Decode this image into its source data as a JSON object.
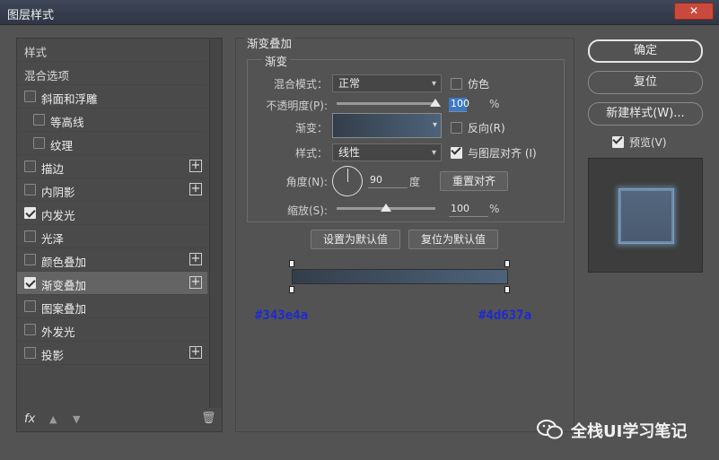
{
  "window": {
    "title": "图层样式",
    "close_label": "✕"
  },
  "sidebar": {
    "items": [
      {
        "label": "样式",
        "type": "header"
      },
      {
        "label": "混合选项",
        "type": "header"
      },
      {
        "label": "斜面和浮雕",
        "checked": false,
        "plus": false
      },
      {
        "label": "等高线",
        "checked": false,
        "plus": false,
        "indent": true
      },
      {
        "label": "纹理",
        "checked": false,
        "plus": false,
        "indent": true
      },
      {
        "label": "描边",
        "checked": false,
        "plus": true
      },
      {
        "label": "内阴影",
        "checked": false,
        "plus": true
      },
      {
        "label": "内发光",
        "checked": true,
        "plus": false
      },
      {
        "label": "光泽",
        "checked": false,
        "plus": false
      },
      {
        "label": "颜色叠加",
        "checked": false,
        "plus": true
      },
      {
        "label": "渐变叠加",
        "checked": true,
        "plus": true,
        "selected": true
      },
      {
        "label": "图案叠加",
        "checked": false,
        "plus": false
      },
      {
        "label": "外发光",
        "checked": false,
        "plus": false
      },
      {
        "label": "投影",
        "checked": false,
        "plus": true
      }
    ],
    "fx_label": "fx",
    "plus_glyph": "+"
  },
  "panel": {
    "title": "渐变叠加",
    "subtitle": "渐变",
    "blend_mode_label": "混合模式：",
    "blend_mode_value": "正常",
    "dither_label": "仿色",
    "opacity_label": "不透明度(P):",
    "opacity_value": "100",
    "opacity_unit": "%",
    "opacity_level": 1.0,
    "gradient_label": "渐变：",
    "reverse_label": "反向(R)",
    "style_label": "样式：",
    "style_value": "线性",
    "align_label": "与图层对齐 (I)",
    "angle_label": "角度(N):",
    "angle_value": "90",
    "angle_unit": "度",
    "reset_align_label": "重置对齐",
    "scale_label": "缩放(S):",
    "scale_value": "100",
    "scale_unit": "%",
    "scale_level": 0.5,
    "set_default_label": "设置为默认值",
    "reset_default_label": "复位为默认值"
  },
  "gradient": {
    "start_color": "#343e4a",
    "end_color": "#4d637a",
    "start_label": "#343e4a",
    "end_label": "#4d637a"
  },
  "right": {
    "ok_label": "确定",
    "reset_label": "复位",
    "new_style_label": "新建样式(W)...",
    "preview_label": "预览(V)"
  },
  "watermark": {
    "text": "全栈UI学习笔记"
  }
}
